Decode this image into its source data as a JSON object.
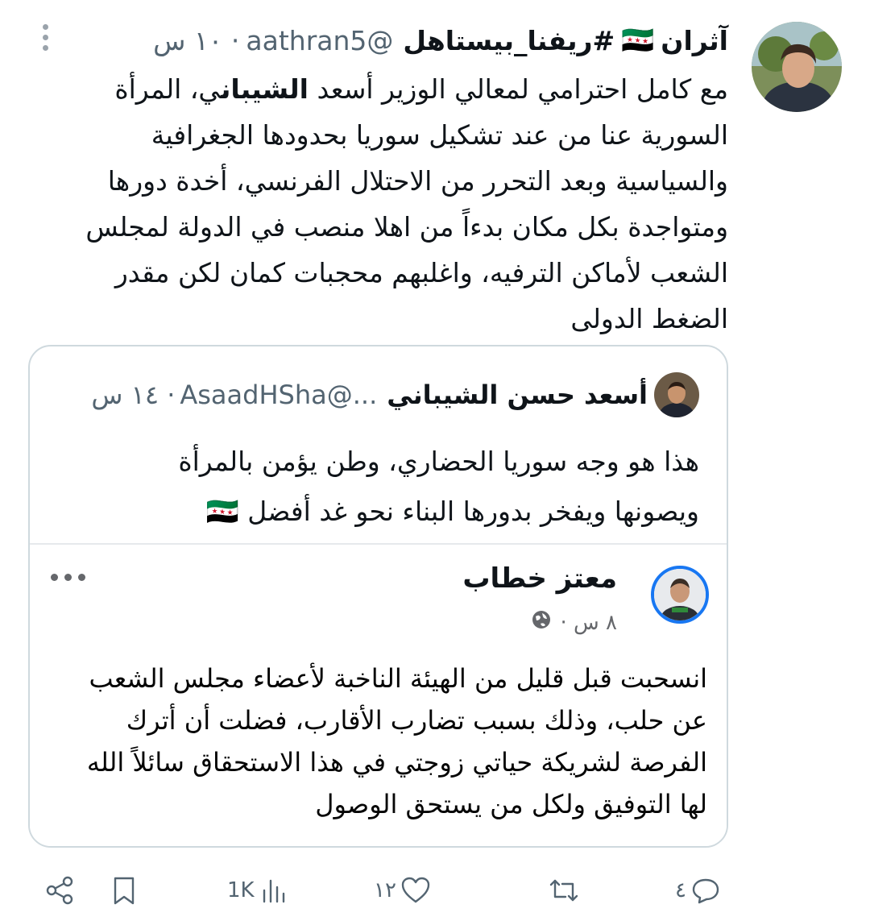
{
  "tweet": {
    "author_name": "آثران",
    "author_flag": "🇸🇾",
    "author_hashtag": "#ريفنا_بيستاهل",
    "handle": "@aathran5",
    "time": "· ١٠ س",
    "text_before_bold": "مع كامل احترامي لمعالي الوزير أسعد ",
    "text_bold": "الشيبان",
    "text_after_bold": "ي، المرأة السورية عنا من عند تشكيل سوريا بحدودها الجغرافية والسياسية وبعد التحرر من الاحتلال الفرنسي، أخدة دورها ومتواجدة بكل مكان بدءاً من اهلا منصب في الدولة لمجلس الشعب لأماكن الترفيه، واغلبهم محجبات كمان لكن مقدر الضغط الدولى"
  },
  "quote": {
    "author_name": "أسعد حسن الشيباني",
    "handle": "...@AsaadHSha",
    "time": "· ١٤ س",
    "text_line1": "هذا هو وجه سوريا الحضاري، وطن يؤمن بالمرأة",
    "text_line2": "ويصونها ويفخر بدورها البناء نحو غد أفضل 🇸🇾"
  },
  "fb_post": {
    "author_name": "معتز خطاب",
    "time": "٨ س ·",
    "text": "انسحبت قبل قليل من الهيئة الناخبة لأعضاء مجلس الشعب عن حلب، وذلك بسبب تضارب الأقارب، فضلت أن أترك الفرصة لشريكة حياتي زوجتي في هذا الاستحقاق سائلاً الله لها التوفيق ولكل من يستحق الوصول"
  },
  "actions": {
    "replies": "٤",
    "retweets": "",
    "likes": "١٢",
    "views": "1K"
  },
  "icons": [
    "more-icon",
    "reply-icon",
    "retweet-icon",
    "like-icon",
    "views-icon",
    "bookmark-icon",
    "share-icon",
    "globe-icon"
  ]
}
